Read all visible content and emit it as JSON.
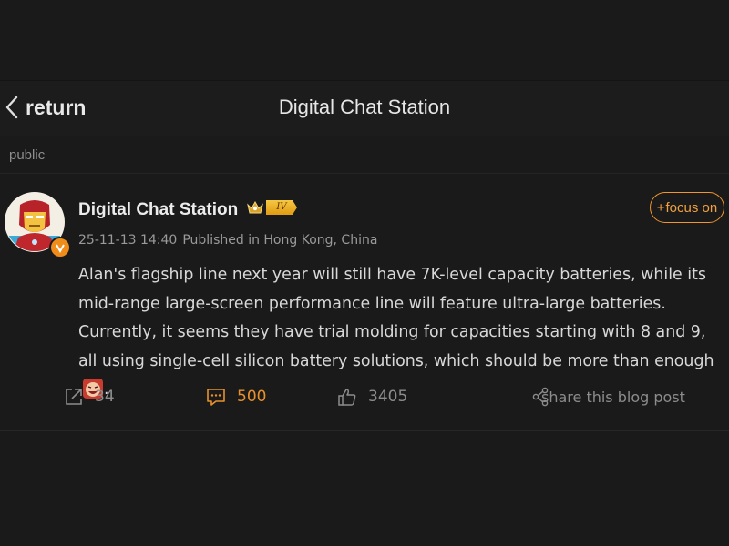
{
  "nav": {
    "back_label": "return",
    "title": "Digital Chat Station"
  },
  "visibility": "public",
  "post": {
    "author": "Digital Chat Station",
    "level_badge": "IV",
    "timestamp": "25-11-13 14:40",
    "published_in": "Published in Hong Kong, China",
    "follow_label": "focus on",
    "follow_plus": "+",
    "body": "Alan's flagship line next year will still have 7K-level capacity batteries, while its mid-range large-screen performance line will feature ultra-large batteries. Currently, it seems they have trial molding for capacities starting with 8 and 9, all using single-cell silicon battery solutions, which should be more than enough",
    "body_end": ".",
    "reposts": "34",
    "comments": "500",
    "likes": "3405",
    "share_label": "share this blog post"
  },
  "colors": {
    "background": "#1a1a1a",
    "accent": "#f0962d",
    "muted": "#8c8c8c"
  },
  "icons": {
    "back": "chevron-left-icon",
    "verified": "verified-v-icon",
    "crown": "crown-icon",
    "repost": "repost-icon",
    "comment": "comment-icon",
    "like": "thumbs-up-icon",
    "share": "share-icon",
    "emoji": "laughing-face-emoji"
  }
}
